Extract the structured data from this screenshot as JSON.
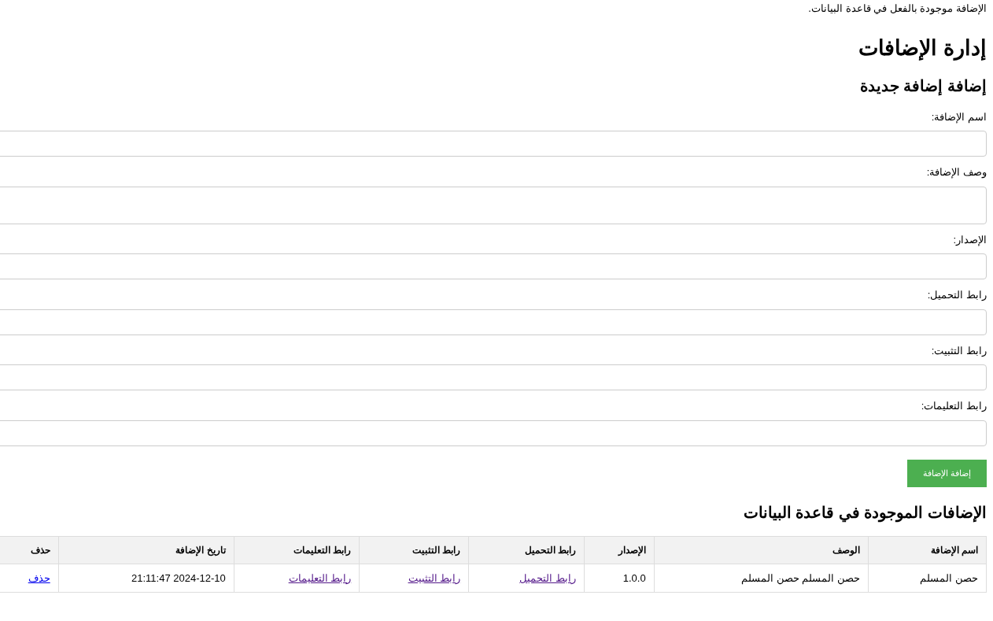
{
  "notice": "الإضافة موجودة بالفعل في قاعدة البيانات.",
  "title": "إدارة الإضافات",
  "form": {
    "heading": "إضافة إضافة جديدة",
    "fields": [
      {
        "label": "اسم الإضافة:",
        "kind": "input"
      },
      {
        "label": "وصف الإضافة:",
        "kind": "textarea"
      },
      {
        "label": "الإصدار:",
        "kind": "input"
      },
      {
        "label": "رابط التحميل:",
        "kind": "input"
      },
      {
        "label": "رابط التثبيت:",
        "kind": "input"
      },
      {
        "label": "رابط التعليمات:",
        "kind": "input"
      }
    ],
    "submit": "إضافة الإضافة"
  },
  "table": {
    "heading": "الإضافات الموجودة في قاعدة البيانات",
    "columns": [
      "اسم الإضافة",
      "الوصف",
      "الإصدار",
      "رابط التحميل",
      "رابط التثبيت",
      "رابط التعليمات",
      "تاريخ الإضافة",
      "حذف"
    ],
    "rows": [
      [
        {
          "kind": "text",
          "text": "حصن المسلم"
        },
        {
          "kind": "text",
          "text": "حصن المسلم حصن المسلم"
        },
        {
          "kind": "text",
          "text": "1.0.0"
        },
        {
          "kind": "link",
          "text": "رابط التحميل",
          "visited": true
        },
        {
          "kind": "link",
          "text": "رابط التثبيت",
          "visited": true
        },
        {
          "kind": "link",
          "text": "رابط التعليمات",
          "visited": true
        },
        {
          "kind": "text",
          "text": "2024-12-10 21:11:47"
        },
        {
          "kind": "link",
          "text": "حذف",
          "visited": false
        }
      ]
    ]
  }
}
